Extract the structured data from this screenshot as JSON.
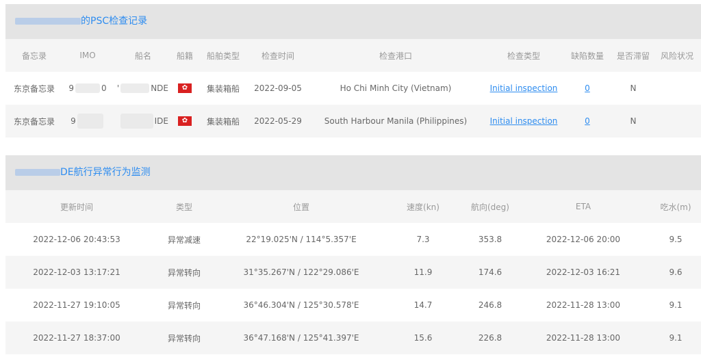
{
  "psc": {
    "title": "的PSC检查记录",
    "headers": [
      "备忘录",
      "IMO",
      "船名",
      "船籍",
      "船舶类型",
      "检查时间",
      "检查港口",
      "检查类型",
      "缺陷数量",
      "是否滞留",
      "风险状况"
    ],
    "rows": [
      {
        "memo": "东京备忘录",
        "imo_prefix": "9",
        "imo_suffix": "0",
        "name_prefix": "'",
        "name_suffix": "NDE",
        "type": "集装箱船",
        "date": "2022-09-05",
        "port": "Ho Chi Minh City (Vietnam)",
        "inspection": "Initial inspection",
        "defects": "0",
        "detained": "N",
        "risk": ""
      },
      {
        "memo": "东京备忘录",
        "imo_prefix": "9",
        "imo_suffix": "",
        "name_prefix": "",
        "name_suffix": "IDE",
        "type": "集装箱船",
        "date": "2022-05-29",
        "port": "South Harbour Manila (Philippines)",
        "inspection": "Initial inspection",
        "defects": "0",
        "detained": "N",
        "risk": ""
      }
    ]
  },
  "abnormal": {
    "title": "DE航行异常行为监测",
    "headers": [
      "更新时间",
      "类型",
      "位置",
      "速度(kn)",
      "航向(deg)",
      "ETA",
      "吃水(m)"
    ],
    "rows": [
      {
        "time": "2022-12-06 20:43:53",
        "type": "异常减速",
        "pos": "22°19.025'N / 114°5.357'E",
        "speed": "7.3",
        "course": "353.8",
        "eta": "2022-12-06 20:00",
        "draft": "9.5"
      },
      {
        "time": "2022-12-03 13:17:21",
        "type": "异常转向",
        "pos": "31°35.267'N / 122°29.086'E",
        "speed": "11.9",
        "course": "174.6",
        "eta": "2022-12-03 16:21",
        "draft": "9.6"
      },
      {
        "time": "2022-11-27 19:10:05",
        "type": "异常转向",
        "pos": "36°46.304'N / 125°30.578'E",
        "speed": "14.7",
        "course": "246.8",
        "eta": "2022-11-28 13:00",
        "draft": "9.1"
      },
      {
        "time": "2022-11-27 18:37:00",
        "type": "异常转向",
        "pos": "36°47.168'N / 125°41.397'E",
        "speed": "15.6",
        "course": "226.8",
        "eta": "2022-11-28 13:00",
        "draft": "9.1"
      }
    ]
  },
  "flag_icon": "hong-kong-flag-icon",
  "colors": {
    "accent": "#2d8cf0",
    "header_bg": "#e4e4e4",
    "row_alt": "#f5f5f5",
    "flag_red": "#d92121"
  }
}
